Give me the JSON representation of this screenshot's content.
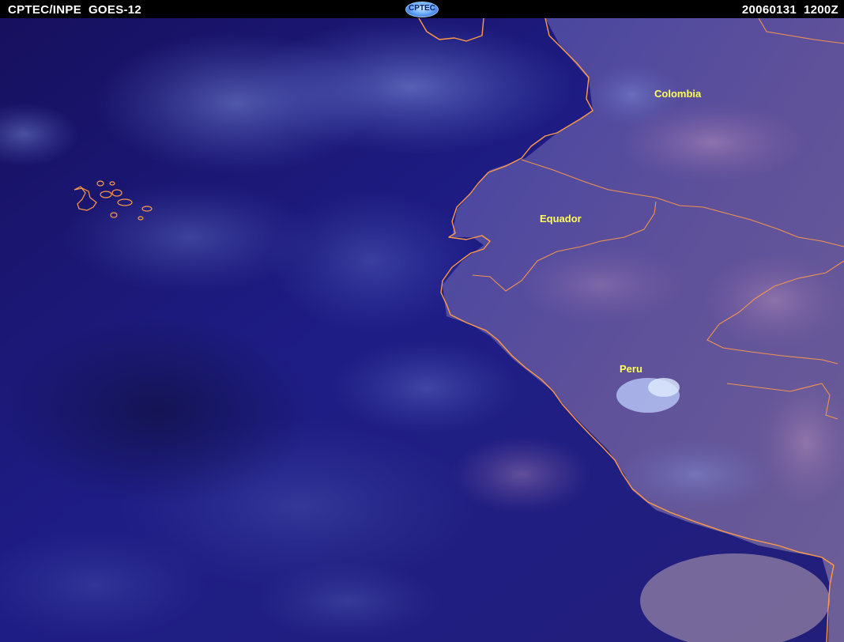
{
  "header": {
    "source": "CPTEC/INPE  GOES-12",
    "timestamp": "20060131  1200Z",
    "logo_text": "CPTEC"
  },
  "map": {
    "labels": {
      "colombia": "Colombia",
      "equador": "Equador",
      "peru": "Peru"
    },
    "colors": {
      "ocean": "#1a1470",
      "land": "#6a5a9a",
      "border": "#ff9a4a",
      "label": "#ffff5a"
    }
  }
}
